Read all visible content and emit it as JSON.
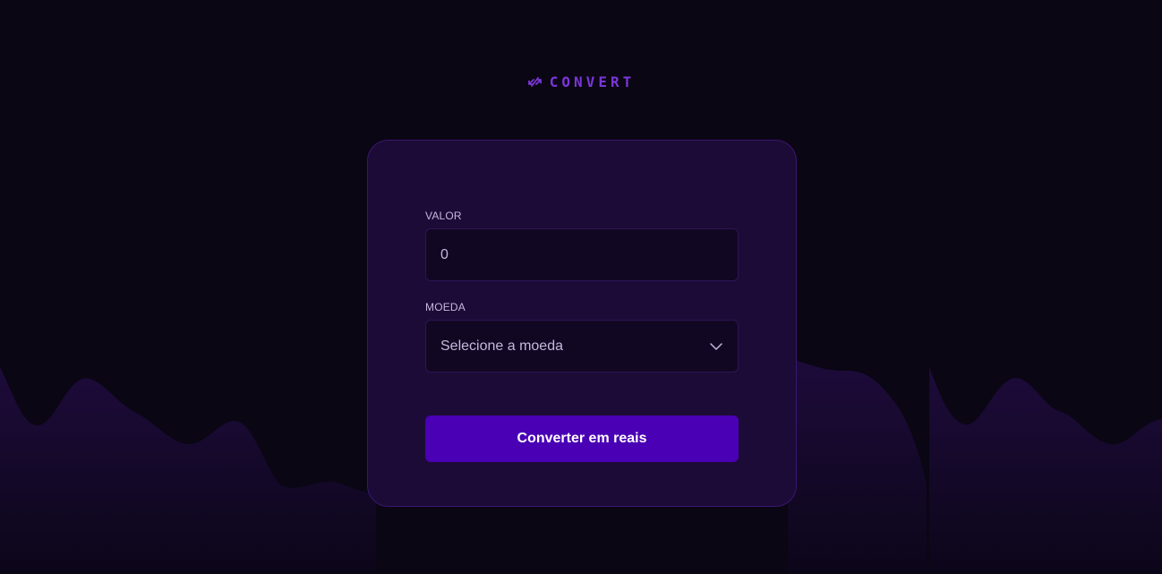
{
  "brand": {
    "name": "CONVERT",
    "icon": "arrows-exchange-icon",
    "color": "#7a36d6"
  },
  "form": {
    "amount_label": "VALOR",
    "amount_value": "0",
    "currency_label": "MOEDA",
    "currency_placeholder": "Selecione a moeda",
    "submit_label": "Converter em reais"
  },
  "colors": {
    "background": "#0a0614",
    "card": "#1c0b36",
    "accent": "#4a00b4",
    "text_muted": "#c6b7dd"
  }
}
